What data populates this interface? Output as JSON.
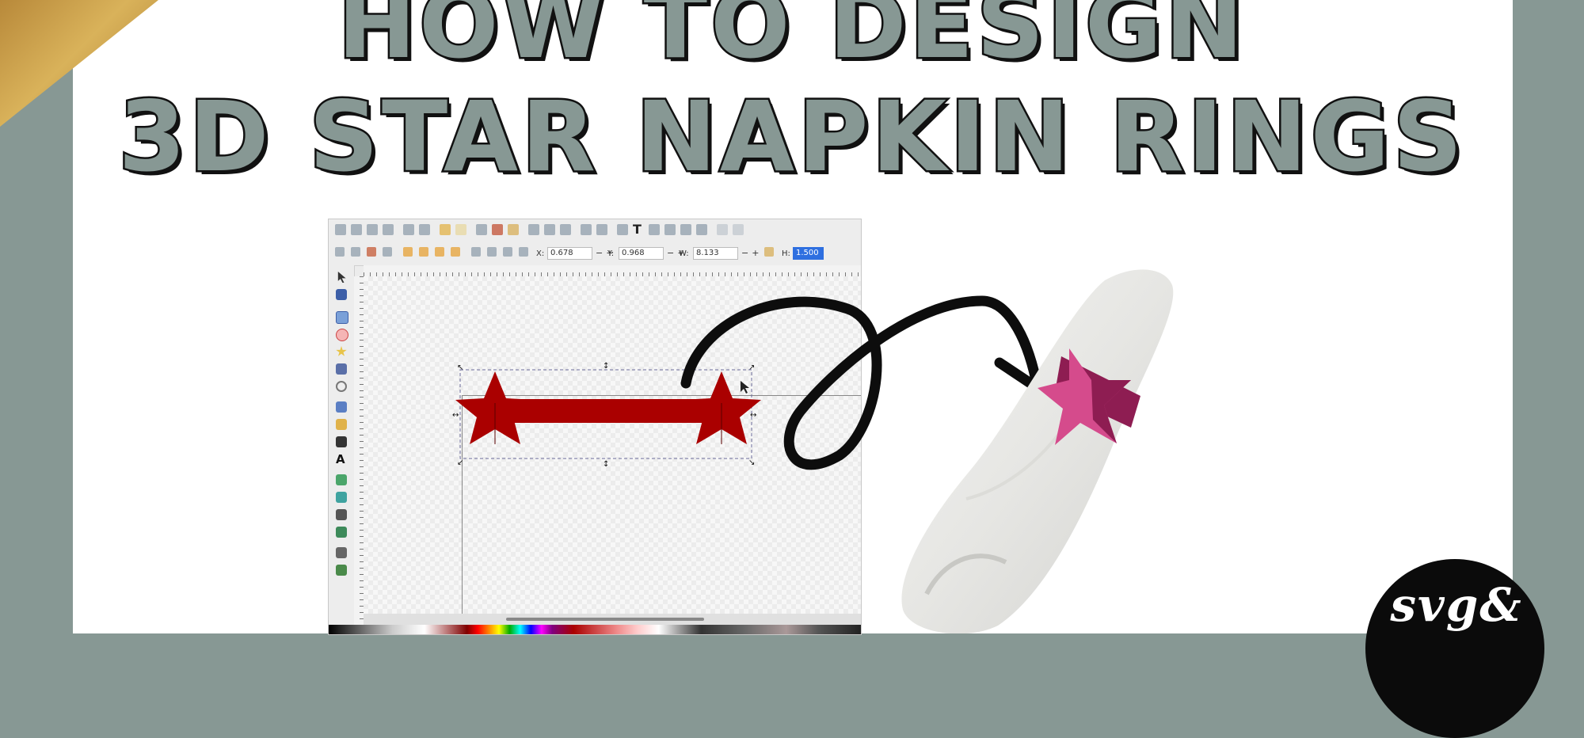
{
  "title": {
    "line1": "HOW TO DESIGN",
    "line2": "3D STAR NAPKIN RINGS"
  },
  "inkscape": {
    "coords": {
      "x_label": "X:",
      "x_value": "0.678",
      "y_label": "Y:",
      "y_value": "0.968",
      "w_label": "W:",
      "w_value": "8.133",
      "h_label": "H:",
      "h_value": "1.500",
      "plus": "+",
      "minus": "−"
    },
    "text_tool_glyph": "T",
    "text_tool_side_glyph": "A",
    "star_color": "#aa0000"
  },
  "logo": {
    "text": "svg&"
  },
  "colors": {
    "background": "#879894",
    "title_fill": "#879894",
    "title_stroke": "#111111",
    "arrow": "#0d0d0d",
    "ring_pink": "#d54b8c",
    "ring_dark": "#8e1d52"
  },
  "icons": [
    "select-tool-icon",
    "node-tool-icon",
    "rect-tool-icon",
    "circle-tool-icon",
    "star-tool-icon",
    "3d-box-tool-icon",
    "spiral-tool-icon",
    "pencil-tool-icon",
    "pen-tool-icon",
    "calligraphy-tool-icon",
    "text-tool-icon",
    "gradient-tool-icon",
    "connector-tool-icon",
    "dropper-tool-icon",
    "paint-bucket-icon",
    "tweak-tool-icon",
    "spray-tool-icon",
    "curved-arrow-icon"
  ]
}
